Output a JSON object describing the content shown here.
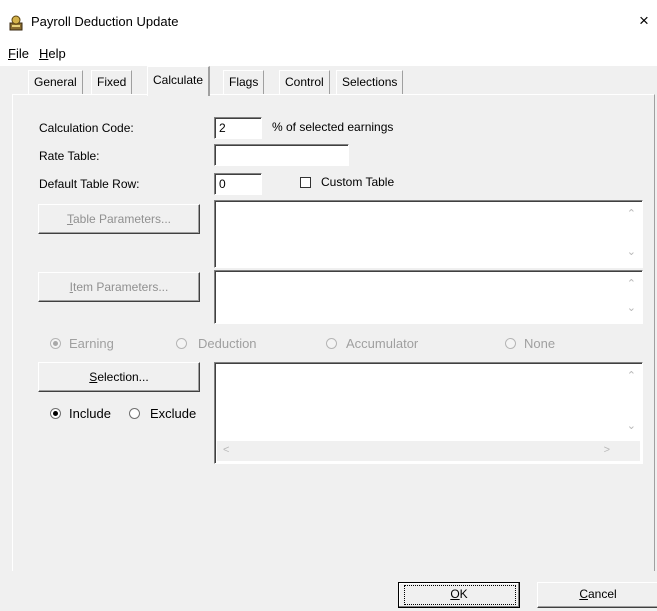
{
  "window": {
    "title": "Payroll Deduction Update",
    "app_icon": "payroll-app-icon",
    "close_glyph": "×"
  },
  "menu": [
    {
      "label": "File",
      "key": "F",
      "rest": "ile"
    },
    {
      "label": "Help",
      "key": "H",
      "rest": "elp"
    }
  ],
  "tabs": [
    "General",
    "Fixed",
    "Calculate",
    "Flags",
    "Control",
    "Selections"
  ],
  "active_tab": "Calculate",
  "form": {
    "calc_code_label": "Calculation Code:",
    "calc_code_value": "2",
    "calc_code_desc": "% of selected earnings",
    "rate_table_label": "Rate Table:",
    "rate_table_value": "",
    "default_row_label": "Default Table Row:",
    "default_row_value": "0",
    "custom_table_label": "Custom Table",
    "custom_table_checked": false
  },
  "buttons": {
    "table_params_key": "T",
    "table_params_rest": "able Parameters...",
    "item_params_key": "I",
    "item_params_rest": "tem Parameters...",
    "selection_key": "S",
    "selection_rest": "election...",
    "ok_key": "O",
    "ok_rest": "K",
    "cancel_key": "C",
    "cancel_rest": "ancel"
  },
  "type_options": [
    {
      "label": "Earning",
      "selected": true,
      "enabled": false
    },
    {
      "label": "Deduction",
      "selected": false,
      "enabled": false
    },
    {
      "label": "Accumulator",
      "selected": false,
      "enabled": false
    },
    {
      "label": "None",
      "selected": false,
      "enabled": false
    }
  ],
  "include_options": [
    {
      "label": "Include",
      "selected": true
    },
    {
      "label": "Exclude",
      "selected": false
    }
  ]
}
